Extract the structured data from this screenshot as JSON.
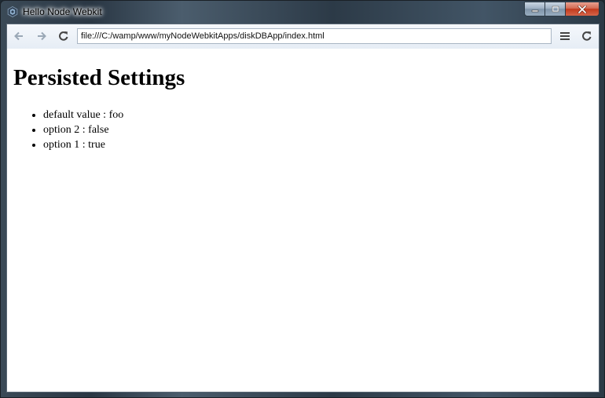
{
  "window": {
    "title": "Hello Node Webkit",
    "icon": "node-webkit-app-icon"
  },
  "toolbar": {
    "address": "file:///C:/wamp/www/myNodeWebkitApps/diskDBApp/index.html",
    "back_icon": "arrow-left-icon",
    "forward_icon": "arrow-right-icon",
    "reload_icon": "reload-icon",
    "menu_icon": "hamburger-menu-icon",
    "refresh_icon": "refresh-icon"
  },
  "page": {
    "heading": "Persisted Settings",
    "settings": [
      "default value : foo",
      "option 2 : false",
      "option 1 : true"
    ]
  },
  "colors": {
    "close_button": "#c2391c",
    "page_background": "#ffffff",
    "toolbar_background": "#eef3f9"
  }
}
